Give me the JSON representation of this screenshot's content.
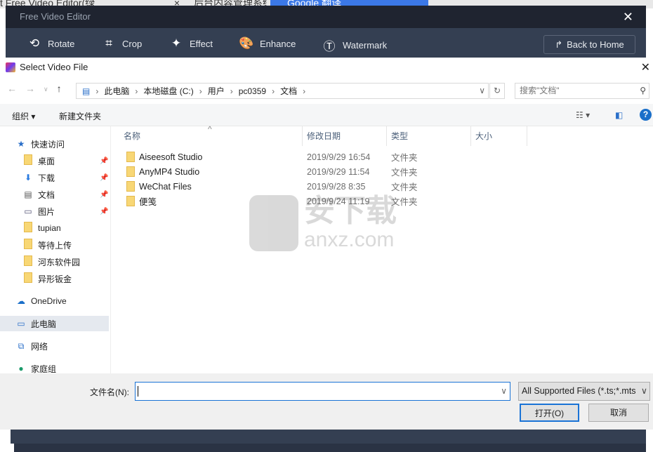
{
  "browser_tabs": [
    {
      "label": "t Free Video Editor(绿"
    },
    {
      "label": "后台内容管理系统 - 安下载"
    },
    {
      "label": "Google 翻译",
      "active": true
    }
  ],
  "app": {
    "title": "Free Video Editor",
    "tools": [
      {
        "label": "Rotate",
        "icon": "rotate-icon"
      },
      {
        "label": "Crop",
        "icon": "crop-icon"
      },
      {
        "label": "Effect",
        "icon": "stars-icon"
      },
      {
        "label": "Enhance",
        "icon": "palette-icon"
      },
      {
        "label": "Watermark",
        "icon": "watermark-icon"
      }
    ],
    "back_home": "Back to Home",
    "colors": {
      "title_bar": "#1f2430",
      "toolbar": "#343f52"
    }
  },
  "dialog": {
    "title": "Select Video File",
    "breadcrumb": [
      "此电脑",
      "本地磁盘 (C:)",
      "用户",
      "pc0359",
      "文档"
    ],
    "search_placeholder": "搜索\"文档\"",
    "organize": "组织 ▾",
    "new_folder": "新建文件夹",
    "sidebar": [
      {
        "label": "快速访问"
      },
      {
        "label": "桌面",
        "pinned": true
      },
      {
        "label": "下载",
        "pinned": true
      },
      {
        "label": "文档",
        "pinned": true
      },
      {
        "label": "图片",
        "pinned": true
      },
      {
        "label": "tupian"
      },
      {
        "label": "等待上传"
      },
      {
        "label": "河东软件园"
      },
      {
        "label": "异形钣金"
      },
      {
        "label": "OneDrive"
      },
      {
        "label": "此电脑",
        "selected": true
      },
      {
        "label": "网络"
      },
      {
        "label": "家庭组"
      }
    ],
    "columns": [
      "名称",
      "修改日期",
      "类型",
      "大小"
    ],
    "files": [
      {
        "name": "Aiseesoft Studio",
        "date": "2019/9/29 16:54",
        "type": "文件夹"
      },
      {
        "name": "AnyMP4 Studio",
        "date": "2019/9/29 11:54",
        "type": "文件夹"
      },
      {
        "name": "WeChat Files",
        "date": "2019/9/28 8:35",
        "type": "文件夹"
      },
      {
        "name": "便笺",
        "date": "2019/9/24 11:19",
        "type": "文件夹"
      }
    ],
    "filename_label": "文件名(N):",
    "filename_value": "",
    "filter": "All Supported Files (*.ts;*.mts",
    "open": "打开(O)",
    "cancel": "取消"
  },
  "watermark": {
    "text": "安下载",
    "sub": "anxz.com"
  }
}
